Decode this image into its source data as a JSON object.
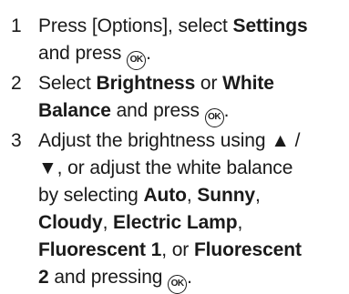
{
  "steps": [
    {
      "number": "1",
      "lines": [
        [
          {
            "t": "text",
            "v": "Press [Options], select "
          },
          {
            "t": "bold",
            "v": "Settings"
          }
        ],
        [
          {
            "t": "text",
            "v": "and press "
          },
          {
            "t": "ok",
            "v": "OK"
          },
          {
            "t": "text",
            "v": "."
          }
        ]
      ]
    },
    {
      "number": "2",
      "lines": [
        [
          {
            "t": "text",
            "v": "Select "
          },
          {
            "t": "bold",
            "v": "Brightness"
          },
          {
            "t": "text",
            "v": " or "
          },
          {
            "t": "bold",
            "v": "White"
          }
        ],
        [
          {
            "t": "bold",
            "v": "Balance"
          },
          {
            "t": "text",
            "v": " and press "
          },
          {
            "t": "ok",
            "v": "OK"
          },
          {
            "t": "text",
            "v": "."
          }
        ]
      ]
    },
    {
      "number": "3",
      "lines": [
        [
          {
            "t": "text",
            "v": "Adjust the brightness using ▲ /"
          }
        ],
        [
          {
            "t": "text",
            "v": "▼, or adjust the white balance"
          }
        ],
        [
          {
            "t": "text",
            "v": "by selecting "
          },
          {
            "t": "bold",
            "v": "Auto"
          },
          {
            "t": "text",
            "v": ", "
          },
          {
            "t": "bold",
            "v": "Sunny"
          },
          {
            "t": "text",
            "v": ","
          }
        ],
        [
          {
            "t": "bold",
            "v": "Cloudy"
          },
          {
            "t": "text",
            "v": ", "
          },
          {
            "t": "bold",
            "v": "Electric Lamp"
          },
          {
            "t": "text",
            "v": ","
          }
        ],
        [
          {
            "t": "bold",
            "v": "Fluorescent 1"
          },
          {
            "t": "text",
            "v": ", or "
          },
          {
            "t": "bold",
            "v": "Fluorescent"
          }
        ],
        [
          {
            "t": "bold",
            "v": "2"
          },
          {
            "t": "text",
            "v": " and pressing "
          },
          {
            "t": "ok",
            "v": "OK"
          },
          {
            "t": "text",
            "v": "."
          }
        ]
      ]
    }
  ]
}
